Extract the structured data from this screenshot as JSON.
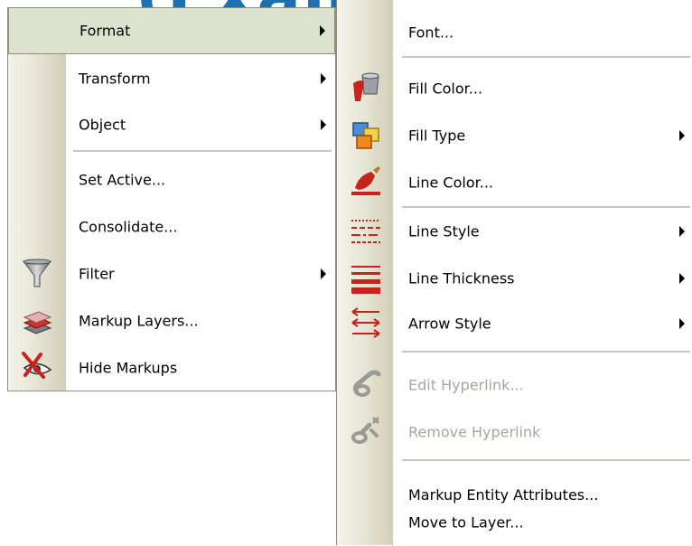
{
  "background_title": "(Example)",
  "left_menu": {
    "items": [
      {
        "label": "Format"
      },
      {
        "label": "Transform"
      },
      {
        "label": "Object"
      },
      {
        "label": "Set Active..."
      },
      {
        "label": "Consolidate..."
      },
      {
        "label": "Filter"
      },
      {
        "label": "Markup Layers..."
      },
      {
        "label": "Hide Markups"
      }
    ]
  },
  "right_menu": {
    "items": [
      {
        "label": "Font..."
      },
      {
        "label": "Fill Color..."
      },
      {
        "label": "Fill Type"
      },
      {
        "label": "Line Color..."
      },
      {
        "label": "Line Style"
      },
      {
        "label": "Line Thickness"
      },
      {
        "label": "Arrow Style"
      },
      {
        "label": "Edit Hyperlink..."
      },
      {
        "label": "Remove Hyperlink"
      },
      {
        "label": "Markup Entity Attributes..."
      },
      {
        "label": "Move to Layer..."
      }
    ]
  },
  "colors": {
    "highlight": "#dde2cf",
    "disabled_text": "#a7a69d",
    "accent_red": "#c8221c",
    "title_blue": "#1c6fb0"
  }
}
